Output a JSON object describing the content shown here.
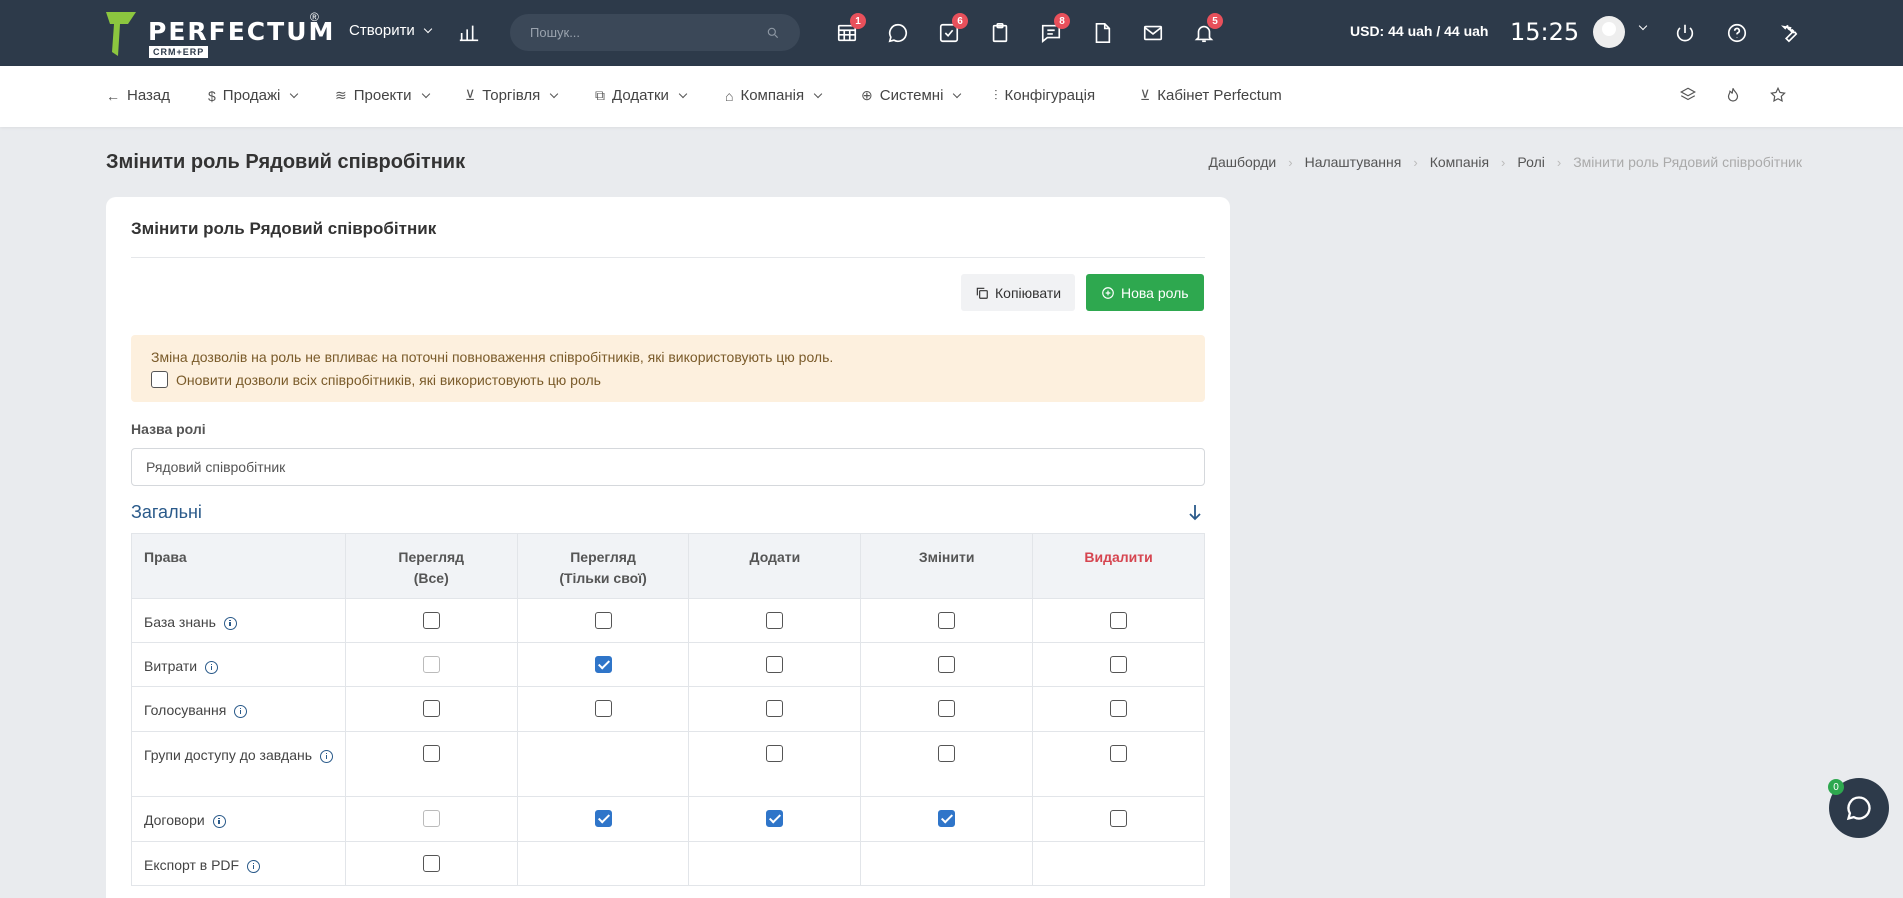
{
  "header": {
    "logo_text": "PERFECTUM",
    "logo_reg": "®",
    "logo_sub": "CRM+ERP",
    "create_label": "Створити",
    "search_placeholder": "Пошук...",
    "badges": {
      "tasks_board": "1",
      "tasks": "6",
      "support": "8",
      "notifications": "5"
    },
    "currency": "USD: 44 uah / 44 uah",
    "time": "15:25"
  },
  "subnav": {
    "items": [
      {
        "label": "Назад",
        "icon": "arrow-left-icon"
      },
      {
        "label": "Продажі",
        "icon": "dollar-icon"
      },
      {
        "label": "Проекти",
        "icon": "layers-icon"
      },
      {
        "label": "Торгівля",
        "icon": "cart-icon"
      },
      {
        "label": "Додатки",
        "icon": "copy-icon"
      },
      {
        "label": "Компанія",
        "icon": "building-icon"
      },
      {
        "label": "Системні",
        "icon": "globe-icon"
      },
      {
        "label": "Конфігурація",
        "icon": "sliders-icon"
      },
      {
        "label": "Кабінет Perfectum",
        "icon": "cart-icon"
      }
    ]
  },
  "page": {
    "title": "Змінити роль Рядовий співробітник",
    "breadcrumb": [
      "Дашборди",
      "Налаштування",
      "Компанія",
      "Ролі",
      "Змінити роль Рядовий співробітник"
    ]
  },
  "card": {
    "title": "Змінити роль Рядовий співробітник",
    "copy_label": "Копіювати",
    "new_role_label": "Нова роль",
    "alert_text": "Зміна дозволів на роль не впливає на поточні повноваження співробітників, які використовують цю роль.",
    "alert_checkbox_label": "Оновити дозволи всіх співробітників, які використовують цю роль",
    "role_name_label": "Назва ролі",
    "role_name_value": "Рядовий співробітник",
    "section_title": "Загальні"
  },
  "table": {
    "headers": [
      "Права",
      "Перегляд",
      "(Все)",
      "Перегляд",
      "(Тільки свої)",
      "Додати",
      "Змінити",
      "Видалити"
    ],
    "rows": [
      {
        "name": "База знань",
        "view_all": "empty",
        "view_own": "empty",
        "add": "empty",
        "edit": "empty",
        "delete": "empty"
      },
      {
        "name": "Витрати",
        "view_all": "disabled",
        "view_own": "checked",
        "add": "empty",
        "edit": "empty",
        "delete": "empty"
      },
      {
        "name": "Голосування",
        "view_all": "empty",
        "view_own": "empty",
        "add": "empty",
        "edit": "empty",
        "delete": "empty"
      },
      {
        "name": "Групи доступу до завдань",
        "view_all": "empty",
        "view_own": "none",
        "add": "empty",
        "edit": "empty",
        "delete": "empty"
      },
      {
        "name": "Договори",
        "view_all": "disabled",
        "view_own": "checked",
        "add": "checked",
        "edit": "checked",
        "delete": "empty"
      },
      {
        "name": "Експорт в PDF",
        "view_all": "empty",
        "view_own": "none",
        "add": "none",
        "edit": "none",
        "delete": "none"
      }
    ]
  },
  "chat": {
    "badge": "0"
  }
}
